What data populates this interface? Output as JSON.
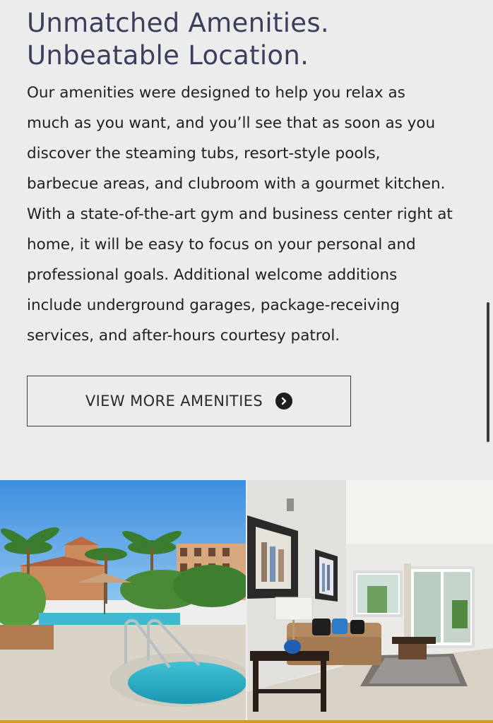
{
  "section": {
    "title_line1": "Unmatched Amenities.",
    "title_line2": "Unbeatable Location.",
    "body_lines": [
      "Our amenities were designed to help you relax as",
      "much as you want, and you’ll see that as soon as you",
      "discover the steaming tubs, resort-style pools,",
      "barbecue areas, and clubroom with a gourmet kitchen.",
      "With a state-of-the-art gym and business center right at",
      "home, it will be easy to focus on your personal and",
      "professional goals. Additional welcome additions",
      "include underground garages, package-receiving",
      "services, and after-hours courtesy patrol."
    ],
    "cta_label": "VIEW MORE AMENITIES",
    "cta_icon": "chevron-right-circle-icon"
  },
  "colors": {
    "title": "#3b3f5c",
    "text": "#1f1f1f",
    "accent_strip": "#d39a2b"
  }
}
